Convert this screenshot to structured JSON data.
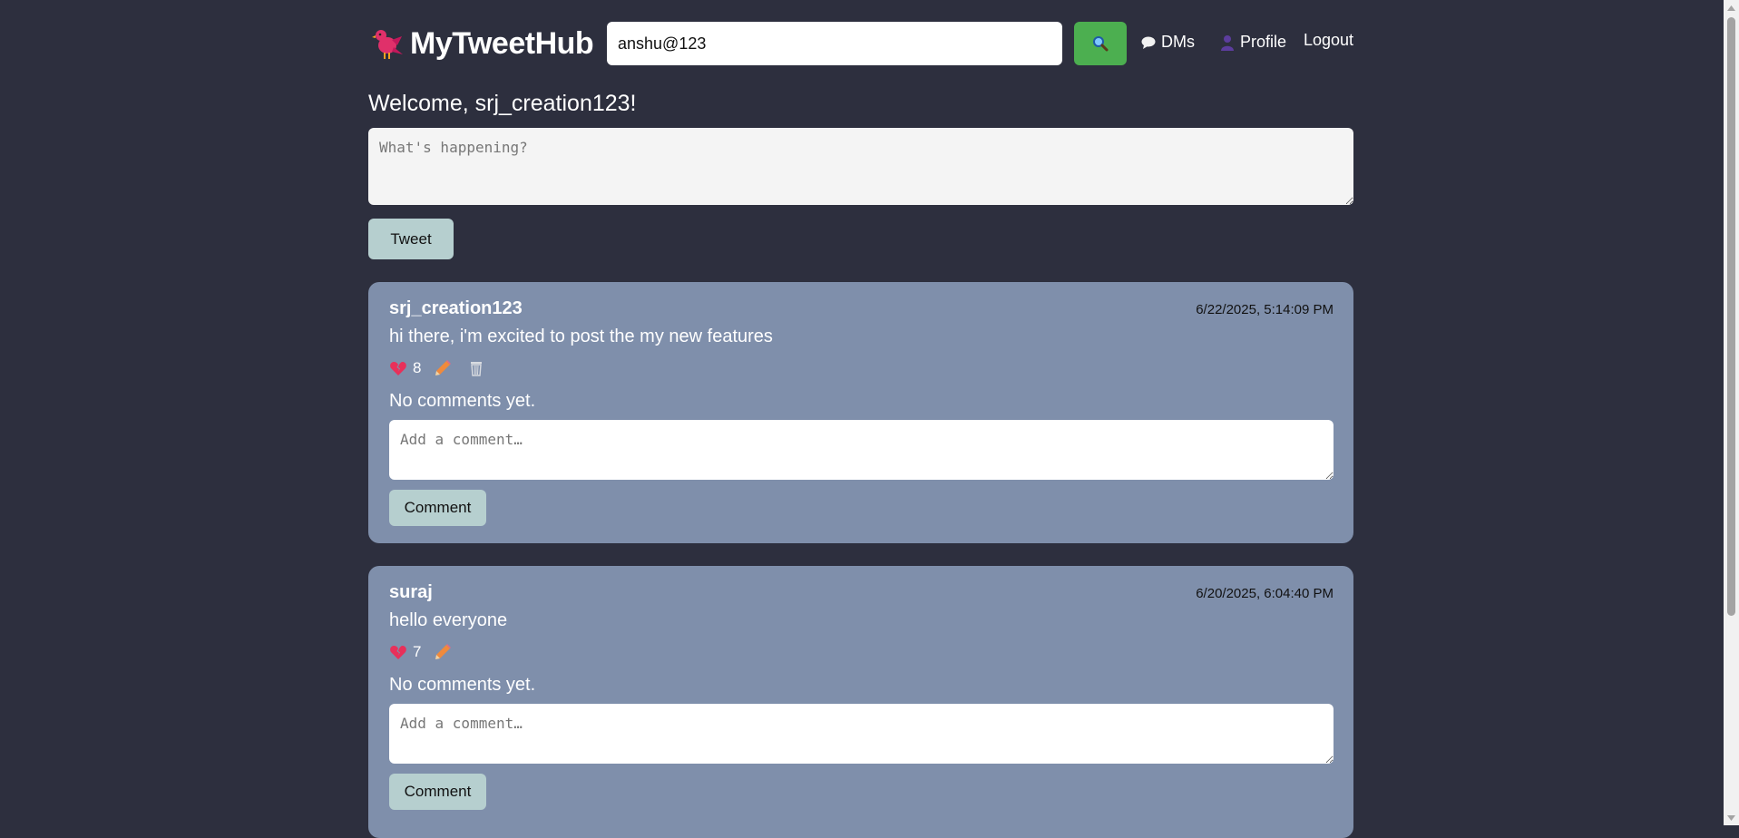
{
  "app": {
    "title": "MyTweetHub"
  },
  "header": {
    "search_value": "anshu@123",
    "dms_label": "DMs",
    "profile_label": "Profile",
    "logout_label": "Logout"
  },
  "welcome": "Welcome, srj_creation123!",
  "compose": {
    "placeholder": "What's happening?",
    "tweet_label": "Tweet"
  },
  "tweets": [
    {
      "username": "srj_creation123",
      "timestamp": "6/22/2025, 5:14:09 PM",
      "text": "hi there, i'm excited to post the my new features",
      "likes": "8",
      "no_comments": "No comments yet.",
      "comment_placeholder": "Add a comment…",
      "comment_label": "Comment",
      "can_delete": true
    },
    {
      "username": "suraj",
      "timestamp": "6/20/2025, 6:04:40 PM",
      "text": "hello everyone",
      "likes": "7",
      "no_comments": "No comments yet.",
      "comment_placeholder": "Add a comment…",
      "comment_label": "Comment",
      "can_delete": false
    }
  ],
  "colors": {
    "background": "#2d2f3e",
    "card": "#7f8fab",
    "search_button": "#4caf50",
    "action_button": "#b6cfcf"
  },
  "icons": {
    "logo": "bird-icon",
    "search": "magnifier-icon",
    "dms": "speech-bubble-icon",
    "profile": "person-icon",
    "like": "broken-heart-icon",
    "edit": "pencil-icon",
    "delete": "wastebasket-icon"
  }
}
